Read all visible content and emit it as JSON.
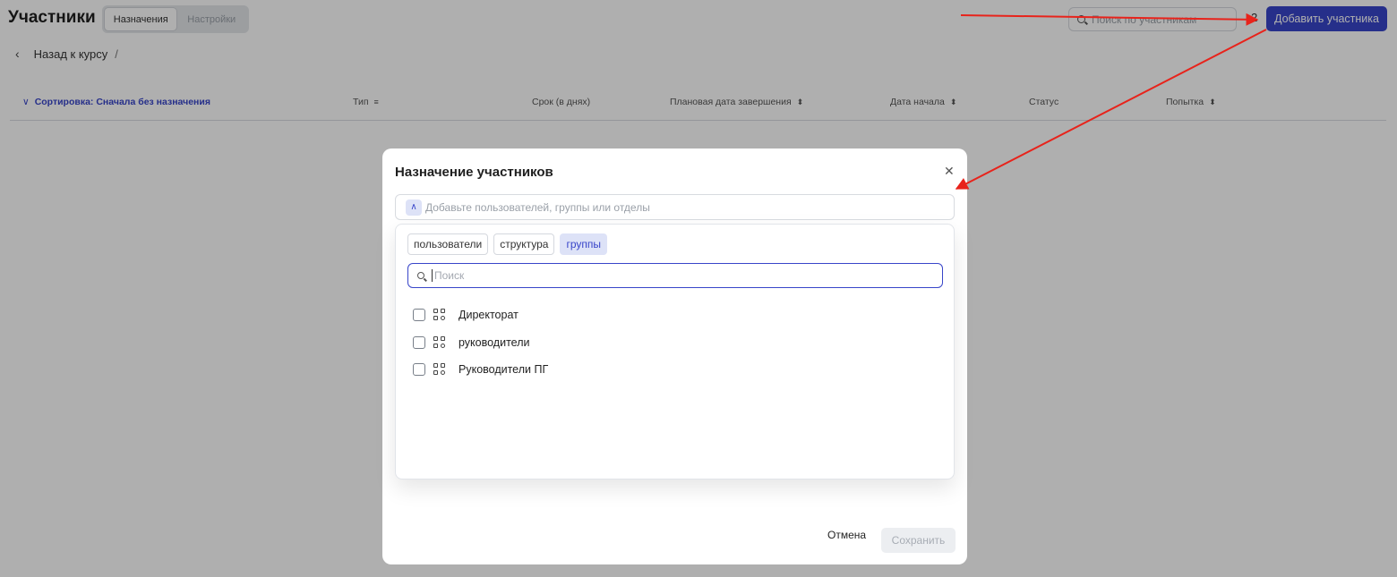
{
  "page": {
    "title": "Участники",
    "tabs": [
      {
        "label": "Назначения",
        "active": true
      },
      {
        "label": "Настройки",
        "active": false
      }
    ],
    "search_placeholder": "Поиск по участникам",
    "count": "2",
    "add_button": "Добавить участника",
    "breadcrumb": {
      "back": "Назад к курсу",
      "separator": "/"
    }
  },
  "table": {
    "sort_label": "Сортировка: Сначала без назначения",
    "columns": [
      {
        "label": "Тип",
        "indicator": "filter-lines"
      },
      {
        "label": "Срок (в днях)",
        "indicator": ""
      },
      {
        "label": "Плановая дата завершения",
        "indicator": "sort-arrows"
      },
      {
        "label": "Дата начала",
        "indicator": "sort-arrows"
      },
      {
        "label": "Статус",
        "indicator": ""
      },
      {
        "label": "Попытка",
        "indicator": "sort-arrows"
      }
    ]
  },
  "modal": {
    "title": "Назначение участников",
    "picker_placeholder": "Добавьте пользователей, группы или отделы",
    "filter_tabs": [
      {
        "label": "пользователи",
        "active": false
      },
      {
        "label": "структура",
        "active": false
      },
      {
        "label": "группы",
        "active": true
      }
    ],
    "search_placeholder": "Поиск",
    "items": [
      {
        "label": "Директорат",
        "checked": false
      },
      {
        "label": "руководители",
        "checked": false
      },
      {
        "label": "Руководители ПГ",
        "checked": false
      }
    ],
    "cancel_label": "Отмена",
    "save_label": "Сохранить"
  },
  "colors": {
    "accent": "#3845c9",
    "accent_light": "#dde2f7",
    "annotation_arrow": "#e8231b"
  }
}
